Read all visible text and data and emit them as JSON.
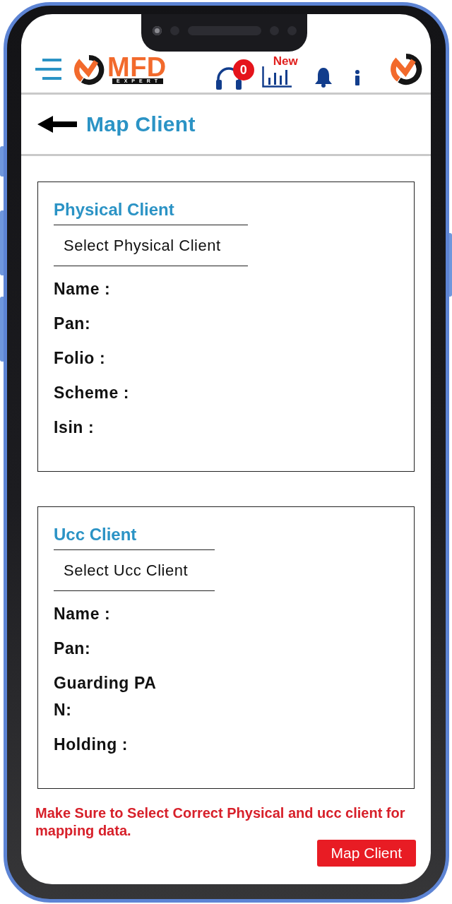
{
  "header": {
    "brand_name": "MFD",
    "brand_tagline": "EXPERT",
    "support_count": "0",
    "reports_badge": "New"
  },
  "page_title": "Map Client",
  "cards": [
    {
      "title": "Physical Client",
      "select": {
        "placeholder": "Select Physical Client"
      },
      "fields": [
        "Name :",
        "Pan:",
        "Folio :",
        "Scheme :",
        "Isin :"
      ]
    },
    {
      "title": "Ucc Client",
      "select": {
        "placeholder": "Select Ucc Client"
      },
      "fields": [
        "Name :",
        "Pan:",
        "Guarding PA\nN:",
        "Holding :"
      ]
    }
  ],
  "warning": "Make Sure to Select Correct Physical and ucc client for mapping data.",
  "submit_button": "Map Client"
}
